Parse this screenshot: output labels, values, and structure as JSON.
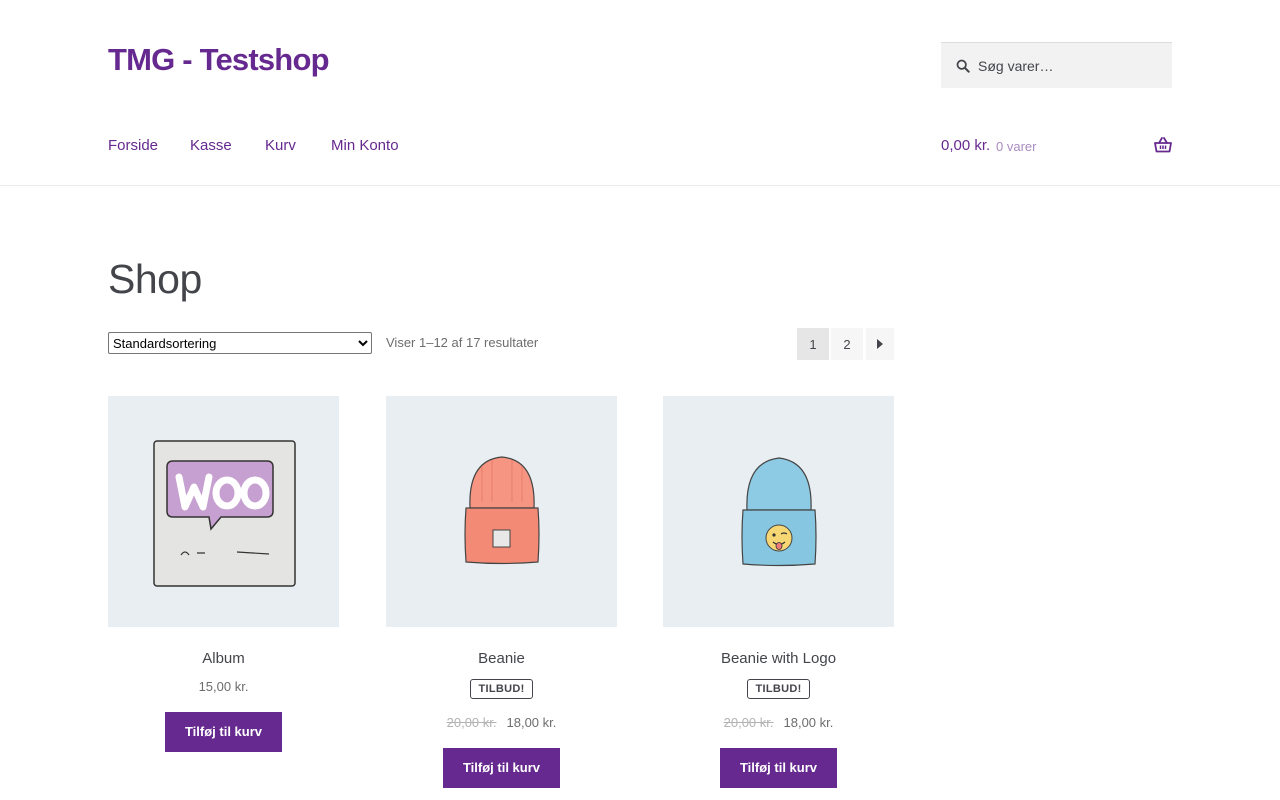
{
  "site": {
    "title": "TMG - Testshop"
  },
  "search": {
    "placeholder": "Søg varer…"
  },
  "nav": {
    "items": [
      {
        "label": "Forside"
      },
      {
        "label": "Kasse"
      },
      {
        "label": "Kurv"
      },
      {
        "label": "Min Konto"
      }
    ]
  },
  "cart": {
    "amount": "0,00 kr.",
    "count": "0 varer"
  },
  "shop": {
    "title": "Shop",
    "sort_selected": "Standardsortering",
    "result_count": "Viser 1–12 af 17 resultater",
    "pagination": {
      "pages": [
        "1",
        "2"
      ],
      "current": "1"
    }
  },
  "products": [
    {
      "name": "Album",
      "price": "15,00 kr.",
      "old_price": "",
      "badge": "",
      "button": "Tilføj til kurv",
      "image_icon": "woo-album-image"
    },
    {
      "name": "Beanie",
      "price": "18,00 kr.",
      "old_price": "20,00 kr.",
      "badge": "TILBUD!",
      "button": "Tilføj til kurv",
      "image_icon": "orange-beanie-image"
    },
    {
      "name": "Beanie with Logo",
      "price": "18,00 kr.",
      "old_price": "20,00 kr.",
      "badge": "TILBUD!",
      "button": "Tilføj til kurv",
      "image_icon": "blue-beanie-image"
    }
  ],
  "colors": {
    "brand": "#66298f",
    "text": "#43454b",
    "image_bg": "#e8eef2"
  }
}
